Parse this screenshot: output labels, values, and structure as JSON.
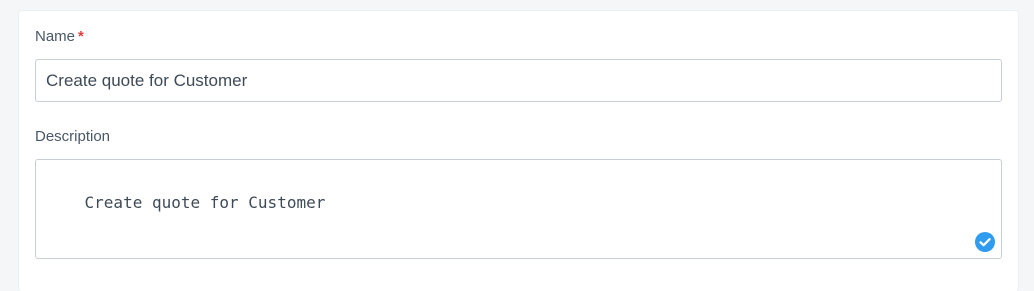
{
  "form": {
    "name_label": "Name",
    "required_marker": "*",
    "name_value": "Create quote for Customer",
    "description_label": "Description",
    "description_value": "Create quote for Customer"
  },
  "icons": {
    "validation": "check-circle-icon"
  },
  "colors": {
    "required": "#e03c3c",
    "check": "#2f9cf0"
  }
}
